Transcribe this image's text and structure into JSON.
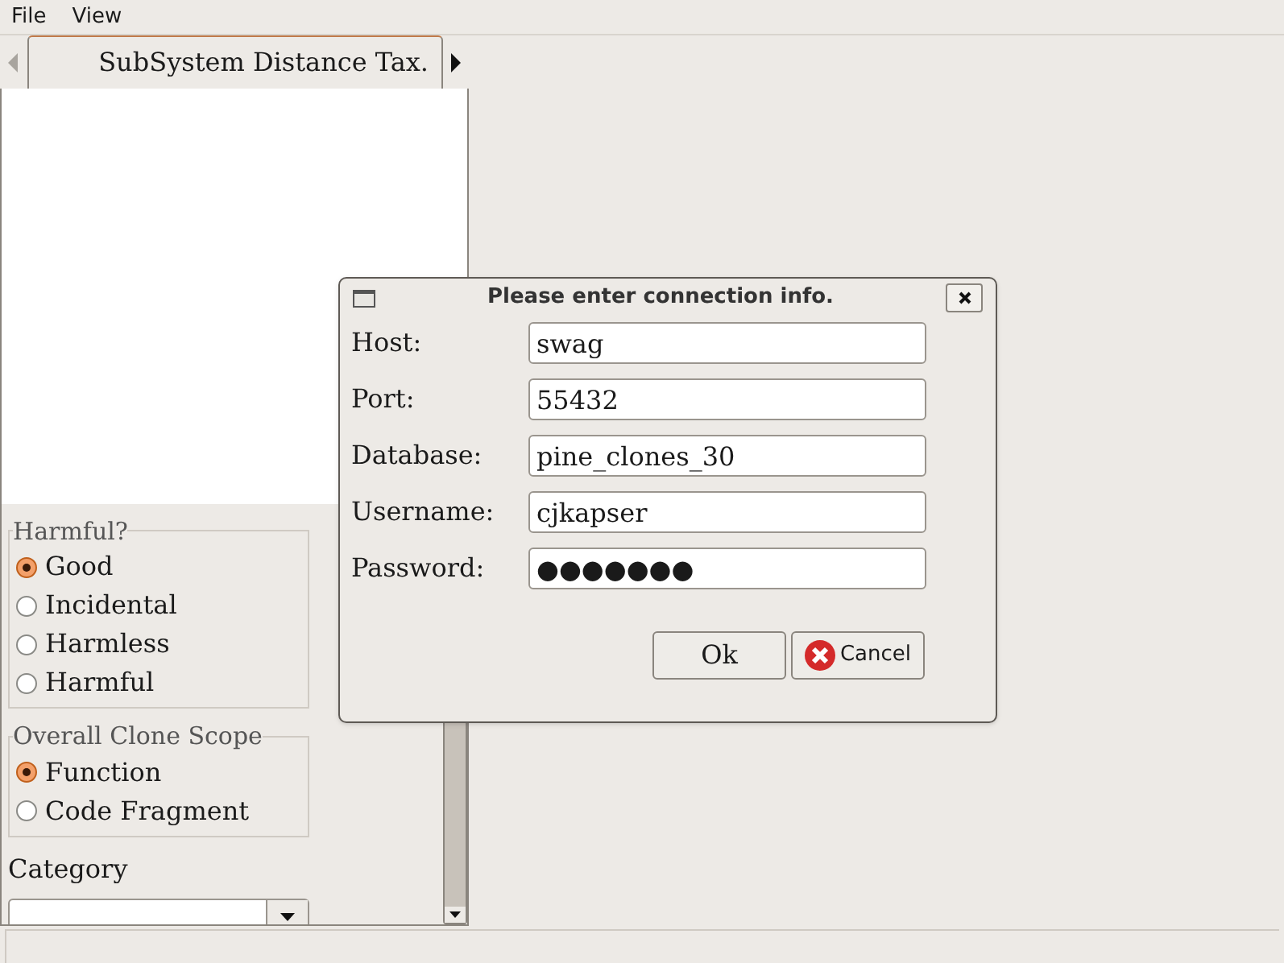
{
  "menu": [
    {
      "label": "File"
    },
    {
      "label": "View"
    }
  ],
  "tabs": [
    {
      "label": "SubSystem Distance Tax.",
      "selected": true
    }
  ],
  "groups": [
    {
      "title": "Harmful?",
      "options": [
        {
          "label": "Good",
          "selected": true
        },
        {
          "label": "Incidental",
          "selected": false
        },
        {
          "label": "Harmless",
          "selected": false
        },
        {
          "label": "Harmful",
          "selected": false
        }
      ]
    },
    {
      "title": "Overall Clone Scope",
      "options": [
        {
          "label": "Function",
          "selected": true
        },
        {
          "label": "Code Fragment",
          "selected": false
        }
      ]
    }
  ],
  "category": {
    "label": "Category"
  },
  "dialog": {
    "title": "Please enter connection info.",
    "fields": [
      {
        "label": "Host:",
        "value": "swag"
      },
      {
        "label": "Port:",
        "value": "55432"
      },
      {
        "label": "Database:",
        "value": "pine_clones_30"
      },
      {
        "label": "Username:",
        "value": "cjkapser"
      },
      {
        "label": "Password:",
        "value": "●●●●●●●"
      }
    ],
    "buttons": [
      {
        "label": "Ok",
        "kind": "plain"
      },
      {
        "label": "Cancel",
        "kind": "cancel"
      }
    ]
  }
}
